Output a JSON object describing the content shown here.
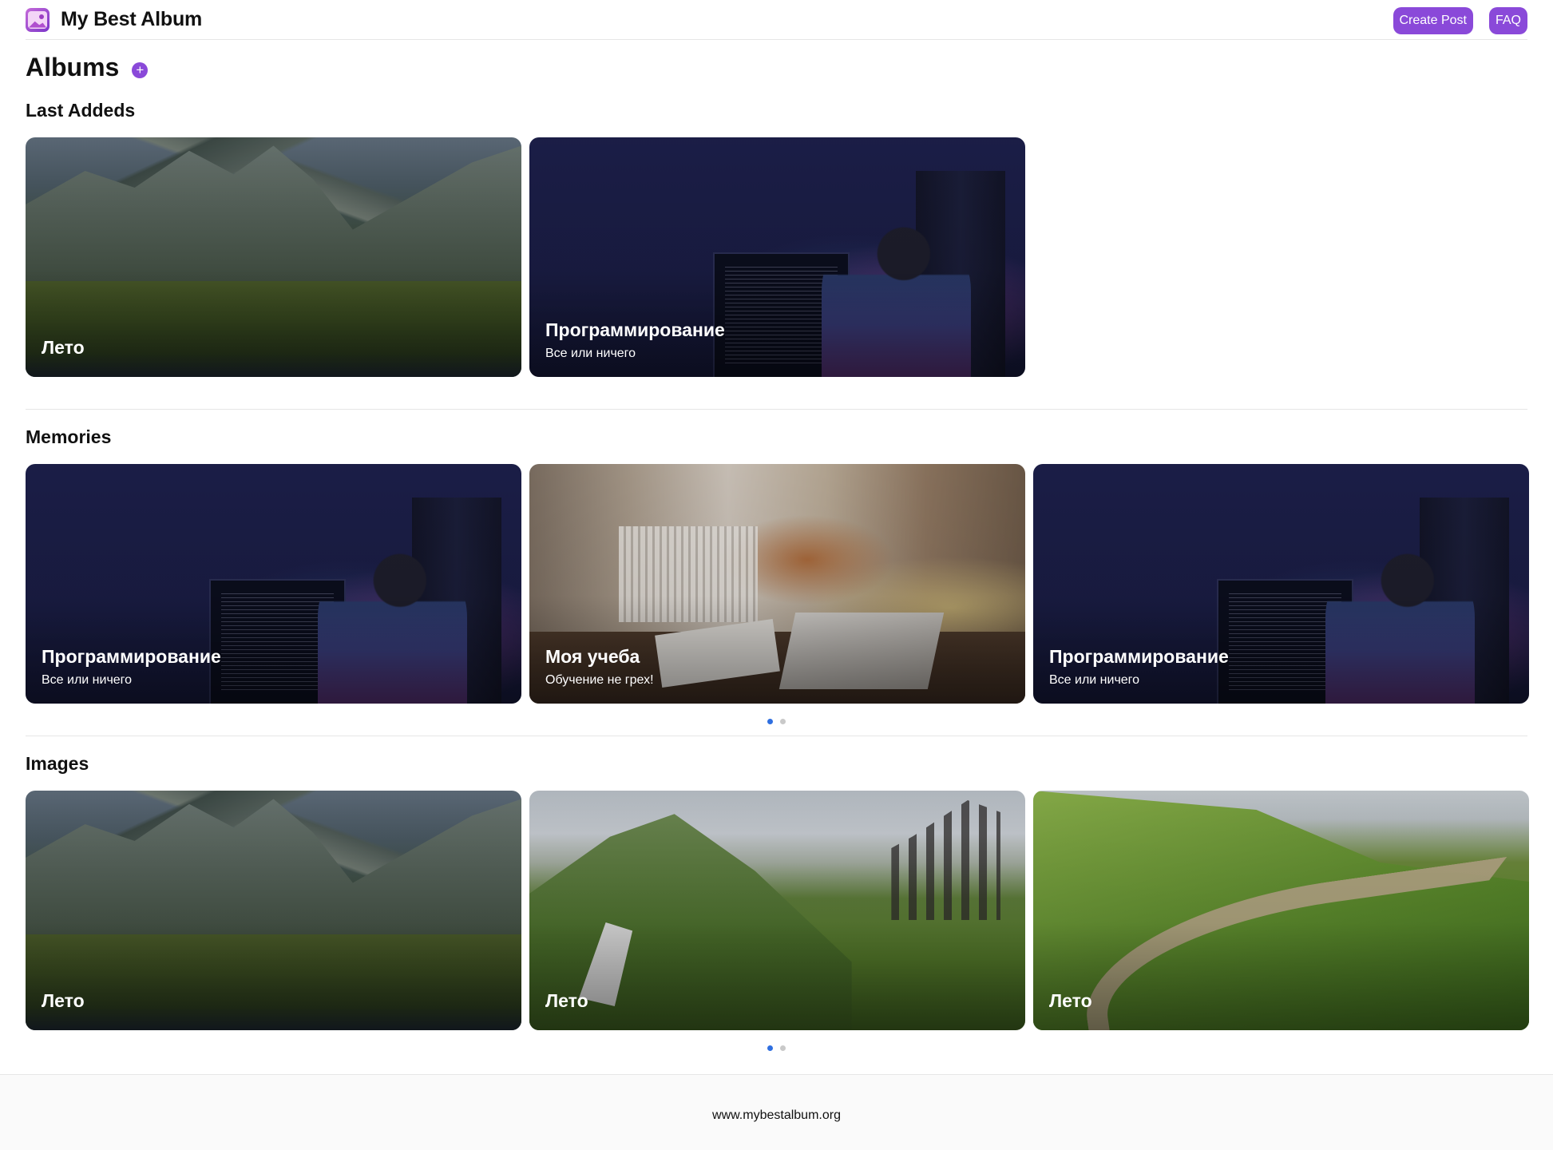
{
  "header": {
    "brand_title": "My Best Album",
    "create_post_label": "Create Post",
    "faq_label": "FAQ"
  },
  "page": {
    "title": "Albums",
    "add_icon": "plus-icon",
    "add_symbol": "+"
  },
  "sections": [
    {
      "title": "Last Addeds",
      "cards": [
        {
          "title": "Лето",
          "subtitle": "",
          "art": "mountains"
        },
        {
          "title": "Программирование",
          "subtitle": "Все или ничего",
          "art": "code"
        }
      ]
    },
    {
      "title": "Memories",
      "cards": [
        {
          "title": "Программирование",
          "subtitle": "Все или ничего",
          "art": "code"
        },
        {
          "title": "Моя учеба",
          "subtitle": "Обучение не грех!",
          "art": "study"
        },
        {
          "title": "Программирование",
          "subtitle": "Все или ничего",
          "art": "code"
        }
      ],
      "pagination": {
        "pages": 2,
        "active": 1
      }
    },
    {
      "title": "Images",
      "cards": [
        {
          "title": "Лето",
          "subtitle": "",
          "art": "mountains"
        },
        {
          "title": "Лето",
          "subtitle": "",
          "art": "hikers"
        },
        {
          "title": "Лето",
          "subtitle": "",
          "art": "road"
        }
      ],
      "pagination": {
        "pages": 2,
        "active": 1
      }
    }
  ],
  "footer": {
    "text": "www.mybestalbum.org"
  },
  "colors": {
    "accent": "#8a49d9",
    "dot_active": "#2f6fe0",
    "dot_inactive": "#c9c9c9"
  }
}
